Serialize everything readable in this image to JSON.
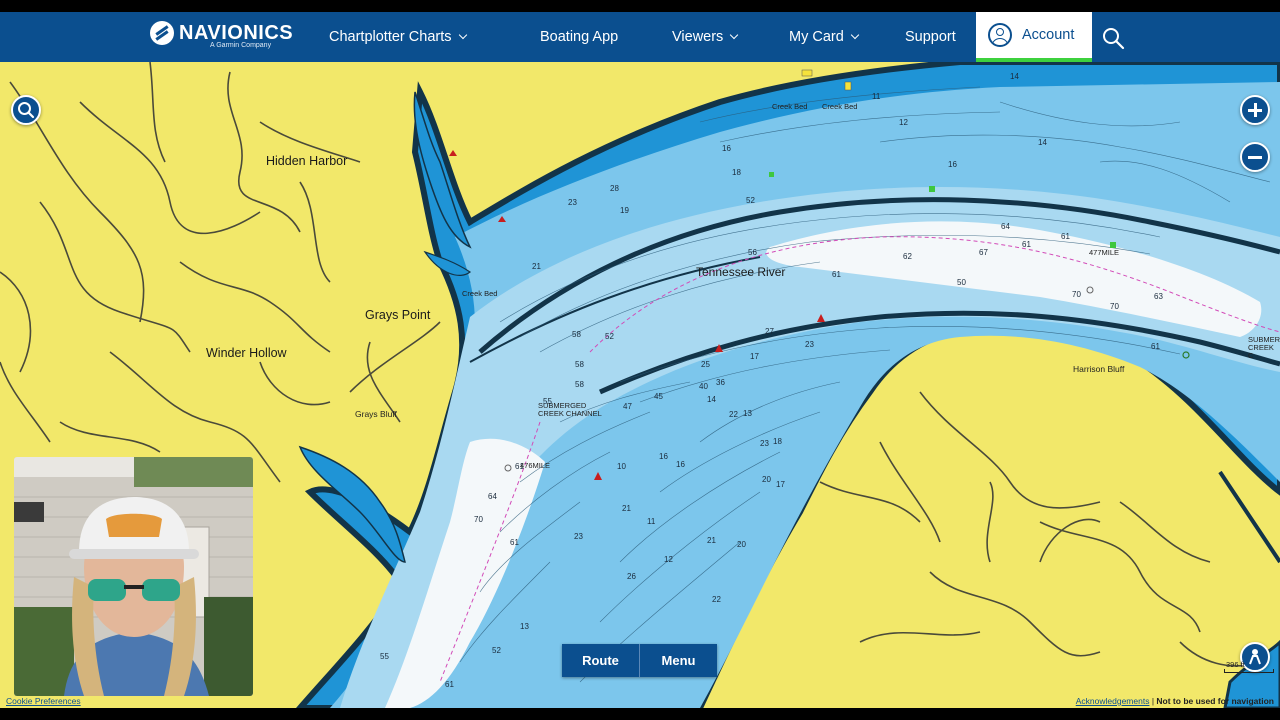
{
  "nav": {
    "brand": "NAVIONICS",
    "brand_sub": "A Garmin Company",
    "items": [
      {
        "label": "Chartplotter Charts",
        "dropdown": true
      },
      {
        "label": "Boating App",
        "dropdown": false
      },
      {
        "label": "Viewers",
        "dropdown": true
      },
      {
        "label": "My Card",
        "dropdown": true
      },
      {
        "label": "Support",
        "dropdown": false
      }
    ],
    "account_label": "Account",
    "search_icon": "search-icon",
    "colors": {
      "bar": "#0b4f8f",
      "active_underline": "#3ed13e"
    }
  },
  "map": {
    "places": {
      "hidden_harbor": "Hidden Harbor",
      "grays_point": "Grays Point",
      "winder_hollow": "Winder Hollow",
      "grays_bluff": "Grays Bluff",
      "tennessee_river": "Tennessee River",
      "harrison_bluff": "Harrison Bluff",
      "submerged_creek_channel": "SUBMERGED CREEK CHANNEL",
      "submerged_creek_right": "SUBMER CREEK C",
      "mile_476": "476MILE",
      "mile_477": "477MILE",
      "creek_bed_1": "Creek Bed",
      "creek_bed_2": "Creek Bed",
      "creek_bed_3": "Creek Bed"
    },
    "depths": [
      "14",
      "11",
      "12",
      "14",
      "16",
      "18",
      "16",
      "52",
      "28",
      "23",
      "19",
      "21",
      "58",
      "61",
      "62",
      "64",
      "67",
      "61",
      "61",
      "70",
      "70",
      "63",
      "61",
      "55",
      "56",
      "58",
      "52",
      "58",
      "50",
      "47",
      "45",
      "40",
      "36",
      "27",
      "25",
      "22",
      "23",
      "16",
      "14",
      "13",
      "10",
      "16",
      "20",
      "18",
      "21",
      "11",
      "12",
      "17",
      "17",
      "23",
      "21",
      "20",
      "22",
      "23",
      "26",
      "13",
      "61",
      "64",
      "70",
      "61",
      "55",
      "61",
      "52"
    ],
    "scale_label": "396 ft",
    "colors": {
      "land": "#f2e86a",
      "deep_water": "#1f94d6",
      "shallow_water": "#a9d9f1",
      "channel": "#e9f5fb",
      "contour": "#123449"
    }
  },
  "controls": {
    "search_icon": "search-icon",
    "zoom_in_icon": "plus-icon",
    "zoom_out_icon": "minus-icon",
    "center_icon": "person-icon",
    "route_label": "Route",
    "menu_label": "Menu"
  },
  "footer": {
    "cookie_label": "Cookie Preferences",
    "ack_label": "Acknowledgements",
    "disclaimer": "Not to be used for navigation"
  }
}
